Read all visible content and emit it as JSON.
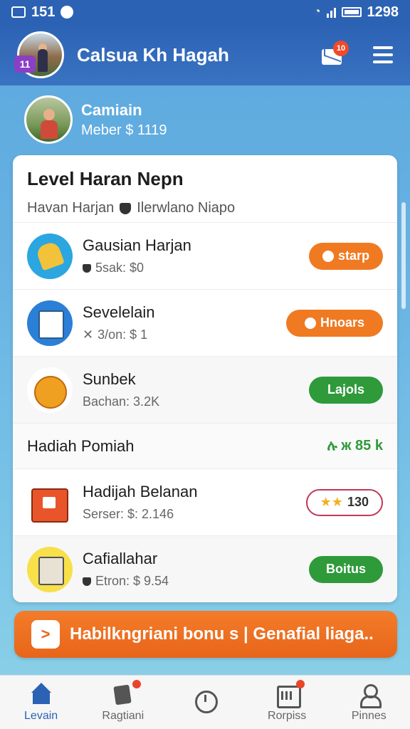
{
  "status_bar": {
    "left_text": "151",
    "time": "1298"
  },
  "header": {
    "title": "Calsua Kh Hagah",
    "level_badge": "11",
    "mail_badge": "10"
  },
  "profile": {
    "name": "Camiain",
    "member": "Meber $ 1119"
  },
  "card": {
    "title": "Level Haran Nepn",
    "subtitle_left": "Havan Harjan",
    "subtitle_right": "Ilerwlano Niapo",
    "rows": [
      {
        "name": "Gausian Harjan",
        "meta": "5sak: $0",
        "button": "starp",
        "icon": "bell-icon"
      },
      {
        "name": "Sevelelain",
        "meta": "3/on: $ 1",
        "button": "Hnoars",
        "icon": "box-icon"
      },
      {
        "name": "Sunbek",
        "meta": "Bachan: 3.2K",
        "button": "Lajols",
        "icon": "candy-icon"
      }
    ],
    "section": {
      "title": "Hadiah Pomiah",
      "value": "ሉ ж 85 k"
    },
    "rows2": [
      {
        "name": "Hadijah Belanan",
        "meta": "Serser: $: 2.146",
        "button": "130",
        "icon": "gift-icon"
      },
      {
        "name": "Cafiallahar",
        "meta": "Etron: $ 9.54",
        "button": "Boitus",
        "icon": "paper-icon"
      }
    ]
  },
  "promo": {
    "text": "Habilkngriani bonu s | Genafial liaga.."
  },
  "nav": [
    {
      "label": "Levain",
      "active": true
    },
    {
      "label": "Ragtiani"
    },
    {
      "label": ""
    },
    {
      "label": "Rorpiss"
    },
    {
      "label": "Pinnes"
    }
  ]
}
